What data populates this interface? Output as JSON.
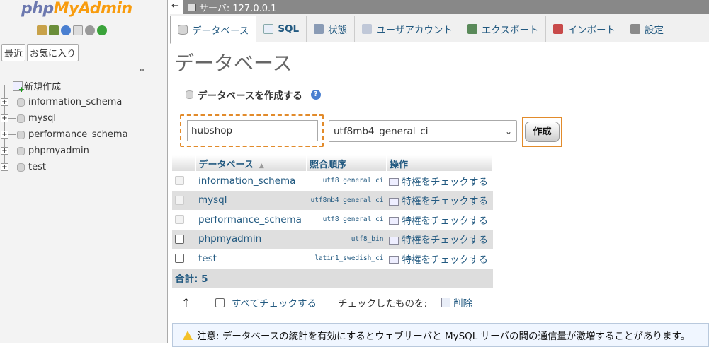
{
  "logo": {
    "php": "php",
    "myadmin": "MyAdmin"
  },
  "nav": {
    "buttons": [
      "最近",
      "お気に入り"
    ],
    "new_label": "新規作成",
    "databases": [
      "information_schema",
      "mysql",
      "performance_schema",
      "phpmyadmin",
      "test"
    ]
  },
  "topbar": {
    "back": "←",
    "server": "サーバ: 127.0.0.1"
  },
  "tabs": [
    {
      "label": "データベース",
      "icon": "database-icon"
    },
    {
      "label": "SQL",
      "icon": "sql-icon"
    },
    {
      "label": "状態",
      "icon": "status-icon"
    },
    {
      "label": "ユーザアカウント",
      "icon": "users-icon"
    },
    {
      "label": "エクスポート",
      "icon": "export-icon"
    },
    {
      "label": "インポート",
      "icon": "import-icon"
    },
    {
      "label": "設定",
      "icon": "settings-icon"
    }
  ],
  "page_title": "データベース",
  "create": {
    "header": "データベースを作成する",
    "db_name_value": "hubshop",
    "collation_value": "utf8mb4_general_ci",
    "button": "作成"
  },
  "table": {
    "headers": [
      "データベース",
      "照合順序",
      "操作"
    ],
    "rows": [
      {
        "name": "information_schema",
        "collation": "utf8_general_ci",
        "action": "特権をチェックする"
      },
      {
        "name": "mysql",
        "collation": "utf8mb4_general_ci",
        "action": "特権をチェックする"
      },
      {
        "name": "performance_schema",
        "collation": "utf8_general_ci",
        "action": "特権をチェックする"
      },
      {
        "name": "phpmyadmin",
        "collation": "utf8_bin",
        "action": "特権をチェックする"
      },
      {
        "name": "test",
        "collation": "latin1_swedish_ci",
        "action": "特権をチェックする"
      }
    ],
    "total": "合計: 5"
  },
  "bottom": {
    "arrow": "↑",
    "check_all": "すべてチェックする",
    "with_selected": "チェックしたものを:",
    "delete": "削除"
  },
  "notice": "注意: データベースの統計を有効にするとウェブサーバと MySQL サーバの間の通信量が激増することがあります。"
}
